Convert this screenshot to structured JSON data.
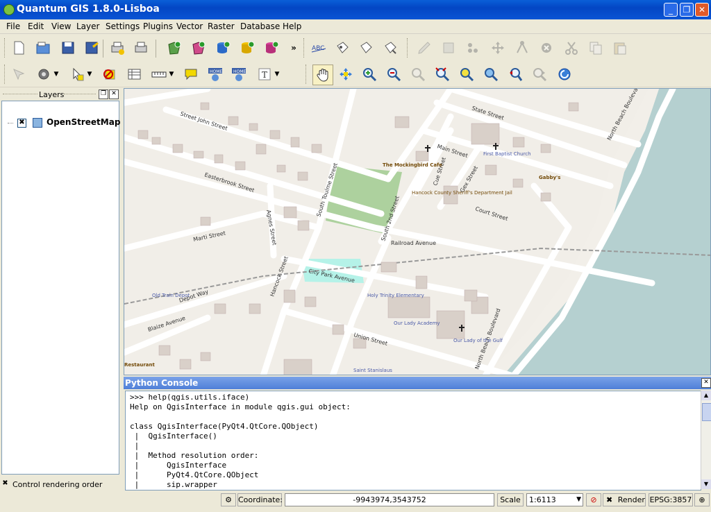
{
  "window": {
    "title": "Quantum GIS 1.8.0-Lisboa"
  },
  "menu": [
    "File",
    "Edit",
    "View",
    "Layer",
    "Settings",
    "Plugins",
    "Vector",
    "Raster",
    "Database",
    "Help"
  ],
  "toolbar": {
    "more": "»"
  },
  "layers": {
    "title": "Layers",
    "items": [
      {
        "name": "OpenStreetMap",
        "checked": "✖"
      }
    ],
    "control_rendering_order": "Control rendering order"
  },
  "map": {
    "streets": [
      "Street John Street",
      "Easterbrook Street",
      "South Toulme Street",
      "Main Street",
      "State Street",
      "Cue Street",
      "Gex Street",
      "Court Street",
      "South 2nd Street",
      "Railroad Avenue",
      "Marti Street",
      "Agnes Street",
      "City Park Avenue",
      "Hancock Street",
      "Depot Way",
      "Blaize Avenue",
      "Union Street",
      "North Beach Boulevard"
    ],
    "pois": [
      "The Mockingbird Cafe",
      "First Baptist Church",
      "Gabby's",
      "Hancock County Sheriff's Department Jail",
      "Holy Trinity Elementary",
      "Our Lady Academy",
      "Our Lady of the Gulf",
      "Old Train Depot",
      "Restaurant",
      "Saint Stanislaus"
    ]
  },
  "console": {
    "title": "Python Console",
    "text": ">>> help(qgis.utils.iface)\nHelp on QgisInterface in module qgis.gui object:\n\nclass QgisInterface(PyQt4.QtCore.QObject)\n |  QgisInterface()\n |\n |  Method resolution order:\n |      QgisInterface\n |      PyQt4.QtCore.QObject\n |      sip.wrapper"
  },
  "status": {
    "coordinate_label": "Coordinate:",
    "coordinate": "-9943974,3543752",
    "scale_label": "Scale",
    "scale": "1:6113",
    "render_label": "Render",
    "render_checked": "✖",
    "crs": "EPSG:3857"
  }
}
